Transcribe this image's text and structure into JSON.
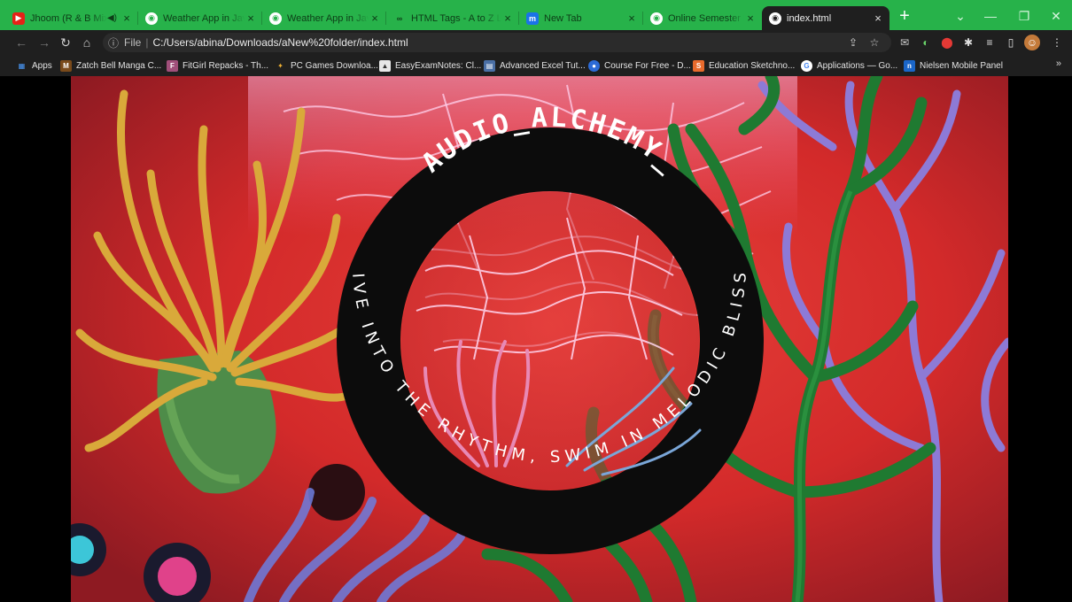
{
  "tabs": [
    {
      "title": "Jhoom (R & B Mix)",
      "favicon": "youtube-icon",
      "close": "×"
    },
    {
      "title": "Weather App in JavaScript",
      "favicon": "globe-icon",
      "close": "×"
    },
    {
      "title": "Weather App in JavaScript",
      "favicon": "globe-icon",
      "close": "×"
    },
    {
      "title": "HTML Tags - A to Z List",
      "favicon": "infinity-icon",
      "close": "×"
    },
    {
      "title": "New Tab",
      "favicon": "m-icon",
      "close": "×"
    },
    {
      "title": "Online Semester Exam",
      "favicon": "globe-icon",
      "close": "×"
    },
    {
      "title": "index.html",
      "favicon": "globe-icon",
      "close": "×",
      "active": true
    }
  ],
  "address": {
    "scheme": "File",
    "url": "C:/Users/abina/Downloads/aNew%20folder/index.html"
  },
  "bookmarks": [
    {
      "label": "Apps",
      "icon": "apps-grid-icon"
    },
    {
      "label": "Zatch Bell Manga C...",
      "icon": "manga-icon"
    },
    {
      "label": "FitGirl Repacks - Th...",
      "icon": "fitgirl-icon"
    },
    {
      "label": "PC Games Downloa...",
      "icon": "pc-games-icon"
    },
    {
      "label": "EasyExamNotes: Cl...",
      "icon": "easyexam-icon"
    },
    {
      "label": "Advanced Excel Tut...",
      "icon": "excel-icon"
    },
    {
      "label": "Course For Free - D...",
      "icon": "course-icon"
    },
    {
      "label": "Education Sketchno...",
      "icon": "sketchnote-icon"
    },
    {
      "label": "Applications — Go...",
      "icon": "google-icon"
    },
    {
      "label": "Nielsen Mobile Panel",
      "icon": "nielsen-icon"
    }
  ],
  "page": {
    "ring_title": "AUDIO_ALCHEMY_",
    "ring_tagline": "DIVE INTO THE RHYTHM, SWIM IN MELODIC BLISS!"
  },
  "colors": {
    "tabstrip": "#27b24a",
    "chrome": "#1f1f1f",
    "ring": "#0c0c0c",
    "ring_text": "#ffffff",
    "art_red": "#d92c2c"
  }
}
